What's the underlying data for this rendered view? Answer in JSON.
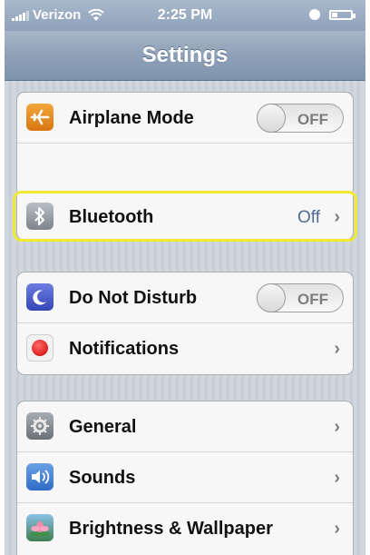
{
  "status_bar": {
    "carrier": "Verizon",
    "time": "2:25 PM"
  },
  "nav": {
    "title": "Settings"
  },
  "groups": [
    {
      "rows": [
        {
          "label": "Airplane Mode",
          "icon": "airplane-icon",
          "control": "toggle",
          "toggle_text": "OFF"
        }
      ]
    },
    {
      "rows": [
        {
          "label": "Bluetooth",
          "icon": "bluetooth-icon",
          "value": "Off",
          "control": "chevron"
        }
      ]
    },
    {
      "rows": [
        {
          "label": "Do Not Disturb",
          "icon": "moon-icon",
          "control": "toggle",
          "toggle_text": "OFF"
        },
        {
          "label": "Notifications",
          "icon": "notifications-icon",
          "control": "chevron"
        }
      ]
    },
    {
      "rows": [
        {
          "label": "General",
          "icon": "gear-icon",
          "control": "chevron"
        },
        {
          "label": "Sounds",
          "icon": "speaker-icon",
          "control": "chevron"
        },
        {
          "label": "Brightness & Wallpaper",
          "icon": "flower-icon",
          "control": "chevron"
        }
      ]
    }
  ],
  "chevron_glyph": "›",
  "colors": {
    "highlight": "#f2e830",
    "nav": "#8fa1b8",
    "value_text": "#4f6b93"
  }
}
